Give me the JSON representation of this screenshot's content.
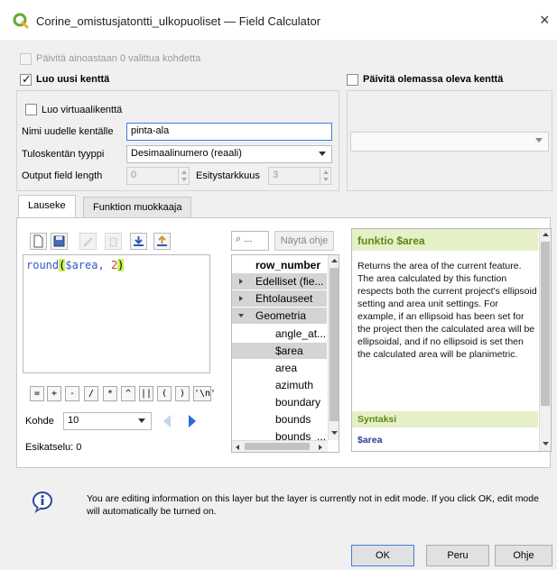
{
  "window": {
    "title": "Corine_omistusjatontti_ulkopuoliset — Field Calculator",
    "close_glyph": "×",
    "app_icon": "qgis-icon"
  },
  "top": {
    "update_selected_only": "Päivitä ainoastaan 0 valittua kohdetta"
  },
  "new_field": {
    "checkbox_label": "Luo uusi kenttä",
    "checked": true,
    "virtual_label": "Luo virtuaalikenttä",
    "name_label": "Nimi uudelle kentälle",
    "name_value": "pinta-ala",
    "type_label": "Tuloskentän tyyppi",
    "type_value": "Desimaalinumero (reaali)",
    "length_label": "Output field length",
    "length_value": "0",
    "precision_label": "Esitystarkkuus",
    "precision_value": "3"
  },
  "update_field": {
    "checkbox_label": "Päivitä olemassa oleva kenttä",
    "checked": false
  },
  "tabs": [
    {
      "label": "Lauseke",
      "active": true
    },
    {
      "label": "Funktion muokkaaja",
      "active": false
    }
  ],
  "toolbar_icons": [
    "new-file-icon",
    "save-icon",
    "edit-icon",
    "delete-icon",
    "import-icon",
    "export-icon"
  ],
  "expression": {
    "fn": "round",
    "open": "(",
    "arg": "$area, ",
    "num": "2",
    "close": ")"
  },
  "operators": [
    "=",
    "+",
    "-",
    "/",
    "*",
    "^",
    "||",
    "(",
    ")",
    "'\\n'"
  ],
  "kohde": {
    "label": "Kohde",
    "value": "10"
  },
  "preview": {
    "label": "Esikatselu:",
    "value": "0"
  },
  "search": {
    "placeholder": "...",
    "show_help_label": "Näytä ohje"
  },
  "tree": {
    "items": [
      {
        "label": "row_number",
        "level": 0,
        "kind": "bold"
      },
      {
        "label": "Edelliset (fie...",
        "level": 0,
        "kind": "group",
        "expander": "right"
      },
      {
        "label": "Ehtolauseet",
        "level": 0,
        "kind": "group",
        "expander": "right"
      },
      {
        "label": "Geometria",
        "level": 0,
        "kind": "group",
        "expander": "down"
      },
      {
        "label": "angle_at...",
        "level": 1,
        "kind": "item"
      },
      {
        "label": "$area",
        "level": 1,
        "kind": "selected"
      },
      {
        "label": "area",
        "level": 1,
        "kind": "item"
      },
      {
        "label": "azimuth",
        "level": 1,
        "kind": "item"
      },
      {
        "label": "boundary",
        "level": 1,
        "kind": "item"
      },
      {
        "label": "bounds",
        "level": 1,
        "kind": "item"
      },
      {
        "label": "bounds_...",
        "level": 1,
        "kind": "item"
      }
    ]
  },
  "help": {
    "title": "funktio $area",
    "body": "Returns the area of the current feature. The area calculated by this function respects both the current project's ellipsoid setting and area unit settings. For example, if an ellipsoid has been set for the project then the calculated area will be ellipsoidal, and if no ellipsoid is set then the calculated area will be planimetric.",
    "syntax_label": "Syntaksi",
    "syntax_code": "$area"
  },
  "info": {
    "icon": "info-icon",
    "message": "You are editing information on this layer but the layer is currently not in edit mode. If you click OK, edit mode will automatically be turned on."
  },
  "buttons": {
    "ok": "OK",
    "cancel": "Peru",
    "help": "Ohje"
  },
  "colors": {
    "accent": "#3c7fd6",
    "help_header_bg": "#e6f0c8",
    "help_header_text": "#5a8a14",
    "expression_highlight": "#c8f05a"
  }
}
